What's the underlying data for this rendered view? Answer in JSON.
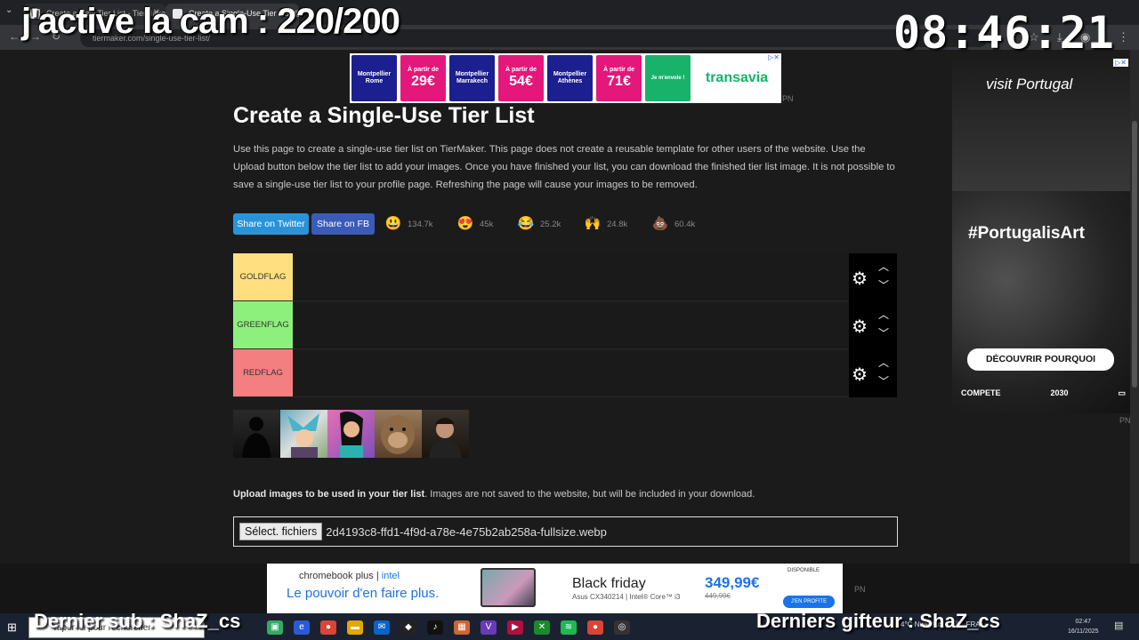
{
  "overlay": {
    "title": "j'active la cam : 220/200",
    "clock": "08:46:21",
    "last_sub": "Dernier sub : ShaZ_cs",
    "last_gifter": "Derniers gifteur : ShaZ_cs"
  },
  "browser": {
    "tabs": [
      {
        "label": "Create a New Tier List - TierMaker"
      },
      {
        "label": "Create a Single-Use Tier List @..."
      }
    ],
    "url": "tiermaker.com/single-use-tier-list/"
  },
  "ads": {
    "top": {
      "tiles": [
        {
          "text": "Montpellier Rome",
          "color": "blue"
        },
        {
          "prefix": "À partir de",
          "price": "29€",
          "color": "pink"
        },
        {
          "text": "Montpellier Marrakech",
          "color": "blue"
        },
        {
          "prefix": "À partir de",
          "price": "54€",
          "color": "pink"
        },
        {
          "text": "Montpellier Athènes",
          "color": "blue"
        },
        {
          "prefix": "À partir de",
          "price": "71€",
          "color": "pink"
        },
        {
          "text": "Je m'envole !",
          "color": "green"
        }
      ],
      "brand": "transavia",
      "pn": "PN"
    },
    "right": {
      "logo": "visit Portugal",
      "hashtag": "#PortugalisArt",
      "button": "DÉCOUVRIR POURQUOI",
      "footer_left": "COMPETE",
      "footer_mid": "2030",
      "pn": "PN"
    },
    "bottom": {
      "brand1": "chromebook plus",
      "brand2": "intel",
      "slogan": "Le pouvoir d'en faire plus.",
      "headline": "Black friday",
      "model": "Asus CX340214 | Intel® Core™ i3",
      "price": "349,99€",
      "old_price": "449,99€",
      "cta": "J'EN PROFITE",
      "dispo": "DISPONIBLE",
      "pn": "PN"
    }
  },
  "page": {
    "title": "Create a Single-Use Tier List",
    "description": "Use this page to create a single-use tier list on TierMaker. This page does not create a reusable template for other users of the website. Use the Upload button below the tier list to add your images. Once you have finished your list, you can download the finished tier list image. It is not possible to save a single-use tier list to your profile page. Refreshing the page will cause your images to be removed.",
    "share_twitter": "Share on Twitter",
    "share_fb": "Share on FB",
    "reactions": [
      {
        "emoji": "😃",
        "count": "134.7k"
      },
      {
        "emoji": "😍",
        "count": "45k"
      },
      {
        "emoji": "😂",
        "count": "25.2k"
      },
      {
        "emoji": "🙌",
        "count": "24.8k"
      },
      {
        "emoji": "💩",
        "count": "60.4k"
      }
    ],
    "tiers": [
      {
        "label": "GOLDFLAG",
        "color": "#ffdf80"
      },
      {
        "label": "GREENFLAG",
        "color": "#8ef07c"
      },
      {
        "label": "REDFLAG",
        "color": "#f47f80"
      }
    ],
    "pool_images": [
      "silhouette",
      "anime-character",
      "cartoon-princess",
      "ape-face",
      "man-portrait"
    ],
    "upload_bold": "Upload images to be used in your tier list",
    "upload_rest": ". Images are not saved to the website, but will be included in your download.",
    "file_button": "Sélect. fichiers",
    "file_name": "2d4193c8-ffd1-4f9d-a78e-4e75b2ab258a-fullsize.webp"
  },
  "taskbar": {
    "search_placeholder": "Taper ici pour rechercher",
    "weather": "4°C Nuageux",
    "lang": "FRA",
    "time": "02:47",
    "date": "16/11/2025"
  }
}
